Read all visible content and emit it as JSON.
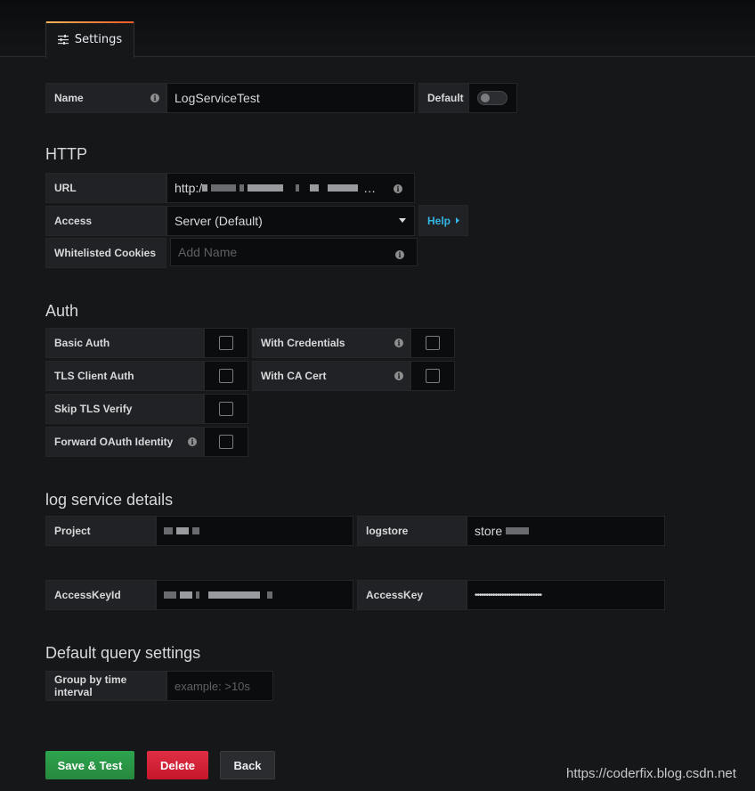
{
  "tabs": {
    "settings_label": "Settings"
  },
  "general": {
    "name_label": "Name",
    "name_value": "LogServiceTest",
    "default_label": "Default"
  },
  "http": {
    "heading": "HTTP",
    "url_label": "URL",
    "url_value": "http:/",
    "url_ellipsis": "…",
    "access_label": "Access",
    "access_value": "Server (Default)",
    "help_label": "Help",
    "cookies_label": "Whitelisted Cookies",
    "cookies_placeholder": "Add Name"
  },
  "auth": {
    "heading": "Auth",
    "basic_auth": "Basic Auth",
    "with_credentials": "With Credentials",
    "tls_client_auth": "TLS Client Auth",
    "with_ca_cert": "With CA Cert",
    "skip_tls_verify": "Skip TLS Verify",
    "forward_oauth": "Forward OAuth Identity"
  },
  "logservice": {
    "heading": "log service details",
    "project_label": "Project",
    "logstore_label": "logstore",
    "logstore_value": "store",
    "accesskeyid_label": "AccessKeyId",
    "accesskey_label": "AccessKey",
    "accesskey_value": "••••••••••••••••••••••••••••••"
  },
  "query": {
    "heading": "Default query settings",
    "group_label": "Group by time interval",
    "group_placeholder": "example: >10s"
  },
  "actions": {
    "save_label": "Save & Test",
    "delete_label": "Delete",
    "back_label": "Back"
  },
  "watermark": "https://coderfix.blog.csdn.net",
  "colors": {
    "save": "#299c46",
    "delete": "#d44a3a",
    "help": "#33b5e5",
    "tab_accent": "#f05a28"
  }
}
